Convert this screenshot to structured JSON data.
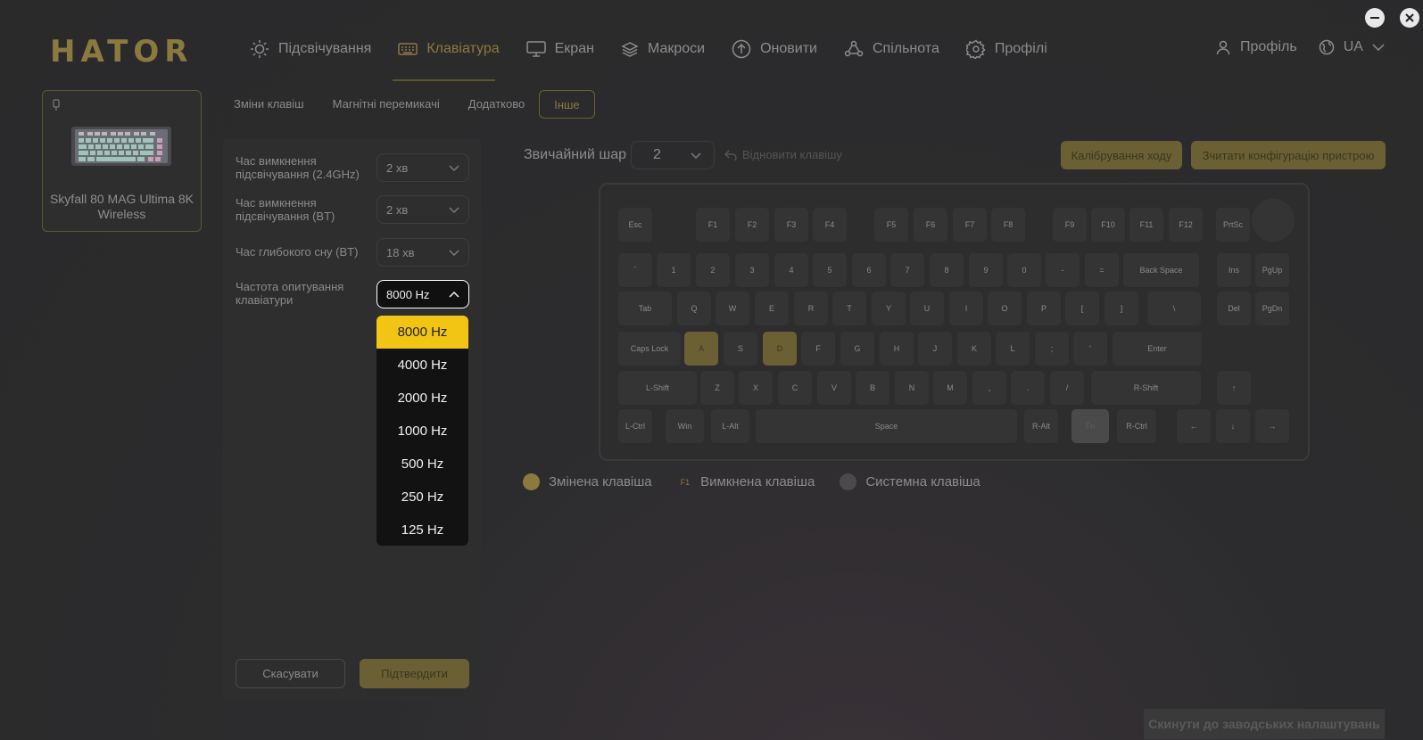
{
  "app": {
    "logo": "HATOR"
  },
  "colors": {
    "accent": "#8a7a3e",
    "accent_bg": "#6b6034",
    "selected": "#f2c414",
    "background": "#2c2c2e"
  },
  "nav": {
    "items": [
      {
        "label": "Підсвічування",
        "icon": "sun-icon"
      },
      {
        "label": "Клавіатура",
        "icon": "keyboard-icon",
        "active": true
      },
      {
        "label": "Екран",
        "icon": "monitor-icon"
      },
      {
        "label": "Макроси",
        "icon": "layers-icon"
      },
      {
        "label": "Оновити",
        "icon": "upload-icon"
      },
      {
        "label": "Спільнота",
        "icon": "community-icon"
      },
      {
        "label": "Профілі",
        "icon": "gear-icon"
      }
    ],
    "profile": "Профіль",
    "language": "UA"
  },
  "device": {
    "name": "Skyfall 80 MAG Ultima 8K Wireless"
  },
  "subtabs": [
    "Зміни клавіш",
    "Магнітні перемикачі",
    "Додатково",
    "Інше"
  ],
  "settings": {
    "rows": [
      {
        "label": "Час вимкнення підсвічування (2.4GHz)",
        "value": "2 хв"
      },
      {
        "label": "Час вимкнення підсвічування (BT)",
        "value": "2 хв"
      },
      {
        "label": "Час глибокого сну (BT)",
        "value": "18 хв"
      },
      {
        "label": "Частота опитування клавіатури",
        "value": "8000 Hz"
      }
    ],
    "polling_options": [
      "8000 Hz",
      "4000 Hz",
      "2000 Hz",
      "1000 Hz",
      "500 Hz",
      "250 Hz",
      "125 Hz"
    ],
    "cancel": "Скасувати",
    "confirm": "Підтвердити"
  },
  "layer": {
    "label": "Звичайний шар",
    "value": "2",
    "restore": "Відновити клавішу"
  },
  "actions": {
    "calibrate": "Калібрування ходу",
    "read_config": "Зчитати конфігурацію пристрою",
    "reset": "Скинути до заводських налаштувань"
  },
  "legend": {
    "modified": "Змінена клавіша",
    "disabled_tag": "F1",
    "disabled": "Вимкнена клавіша",
    "system": "Системна клавіша"
  },
  "keys": {
    "r0": [
      "Esc",
      "F1",
      "F2",
      "F3",
      "F4",
      "F5",
      "F6",
      "F7",
      "F8",
      "F9",
      "F10",
      "F11",
      "F12",
      "PrtSc"
    ],
    "r1": [
      "`",
      "1",
      "2",
      "3",
      "4",
      "5",
      "6",
      "7",
      "8",
      "9",
      "0",
      "-",
      "=",
      "Back Space",
      "Ins",
      "PgUp"
    ],
    "r2": [
      "Tab",
      "Q",
      "W",
      "E",
      "R",
      "T",
      "Y",
      "U",
      "I",
      "O",
      "P",
      "[",
      "]",
      "\\",
      "Del",
      "PgDn"
    ],
    "r3": [
      "Caps Lock",
      "A",
      "S",
      "D",
      "F",
      "G",
      "H",
      "J",
      "K",
      "L",
      ";",
      "'",
      "Enter"
    ],
    "r4": [
      "L-Shift",
      "Z",
      "X",
      "C",
      "V",
      "B",
      "N",
      "M",
      ",",
      ".",
      "/",
      "R-Shift",
      "↑"
    ],
    "r5": [
      "L-Ctrl",
      "Win",
      "L-Alt",
      "Space",
      "R-Alt",
      "Fn",
      "R-Ctrl",
      "←",
      "↓",
      "→"
    ]
  }
}
